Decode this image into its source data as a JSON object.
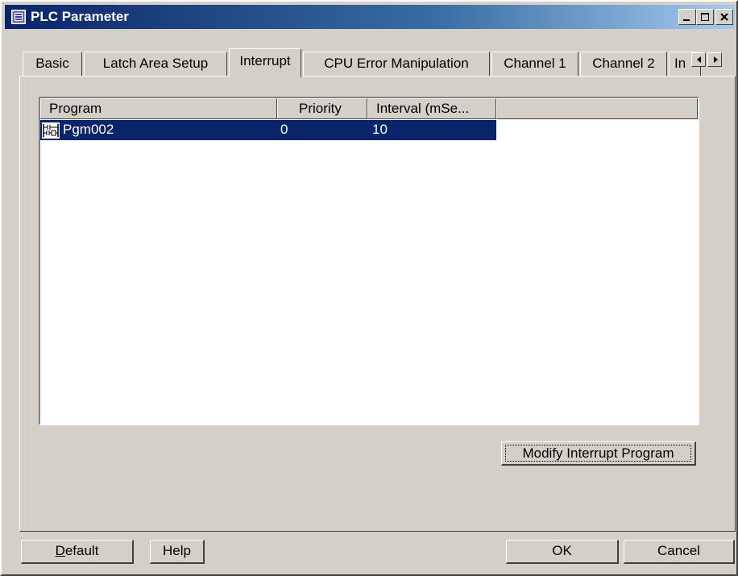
{
  "window": {
    "title": "PLC Parameter"
  },
  "tabs": [
    {
      "label": "Basic",
      "active": false
    },
    {
      "label": "Latch Area Setup",
      "active": false
    },
    {
      "label": "Interrupt",
      "active": true
    },
    {
      "label": "CPU Error Manipulation",
      "active": false
    },
    {
      "label": "Channel 1",
      "active": false
    },
    {
      "label": "Channel 2",
      "active": false
    },
    {
      "label": "In",
      "active": false
    }
  ],
  "list": {
    "columns": [
      "Program",
      "Priority",
      "Interval (mSe..."
    ],
    "rows": [
      {
        "program": "Pgm002",
        "priority": "0",
        "interval": "10",
        "selected": true
      }
    ]
  },
  "buttons": {
    "modify": "Modify Interrupt Program",
    "default_first": "D",
    "default_rest": "efault",
    "help": "Help",
    "ok": "OK",
    "cancel": "Cancel"
  },
  "colors": {
    "title_bar": "#0a246a",
    "face": "#d4d0c8",
    "selection": "#0a246a"
  },
  "icons": [
    "program-icon",
    "minimize-icon",
    "maximize-icon",
    "close-icon",
    "tab-scroll-left-icon",
    "tab-scroll-right-icon",
    "ladder-program-icon"
  ]
}
